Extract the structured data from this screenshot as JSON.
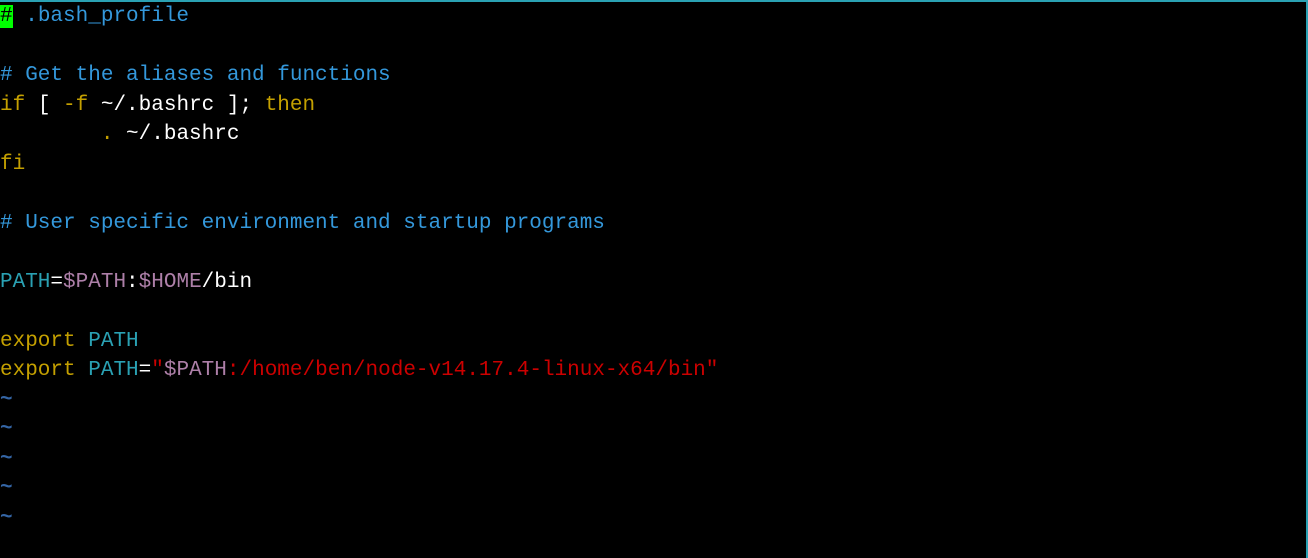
{
  "editor": {
    "lines": [
      {
        "segments": [
          {
            "text": "#",
            "class": "cursor"
          },
          {
            "text": " .bash_profile",
            "class": "comment"
          }
        ]
      },
      {
        "segments": []
      },
      {
        "segments": [
          {
            "text": "# Get the aliases and functions",
            "class": "comment"
          }
        ]
      },
      {
        "segments": [
          {
            "text": "if",
            "class": "keyword"
          },
          {
            "text": " [ ",
            "class": "plain"
          },
          {
            "text": "-f",
            "class": "keyword"
          },
          {
            "text": " ~/.bashrc ",
            "class": "plain"
          },
          {
            "text": "];",
            "class": "plain"
          },
          {
            "text": " ",
            "class": "plain"
          },
          {
            "text": "then",
            "class": "keyword"
          }
        ]
      },
      {
        "segments": [
          {
            "text": "        ",
            "class": "plain"
          },
          {
            "text": ".",
            "class": "keyword"
          },
          {
            "text": " ~/.bashrc",
            "class": "plain"
          }
        ]
      },
      {
        "segments": [
          {
            "text": "fi",
            "class": "keyword"
          }
        ]
      },
      {
        "segments": []
      },
      {
        "segments": [
          {
            "text": "# User specific environment and startup programs",
            "class": "comment"
          }
        ]
      },
      {
        "segments": []
      },
      {
        "segments": [
          {
            "text": "PATH",
            "class": "identifier"
          },
          {
            "text": "=",
            "class": "equals"
          },
          {
            "text": "$PATH",
            "class": "variable"
          },
          {
            "text": ":",
            "class": "plain"
          },
          {
            "text": "$HOME",
            "class": "variable"
          },
          {
            "text": "/bin",
            "class": "plain"
          }
        ]
      },
      {
        "segments": []
      },
      {
        "segments": [
          {
            "text": "export",
            "class": "keyword"
          },
          {
            "text": " ",
            "class": "plain"
          },
          {
            "text": "PATH",
            "class": "identifier"
          }
        ]
      },
      {
        "segments": [
          {
            "text": "export",
            "class": "keyword"
          },
          {
            "text": " ",
            "class": "plain"
          },
          {
            "text": "PATH",
            "class": "identifier"
          },
          {
            "text": "=",
            "class": "equals"
          },
          {
            "text": "\"",
            "class": "string-path"
          },
          {
            "text": "$PATH",
            "class": "variable"
          },
          {
            "text": ":/home/ben/node-v14.17.4-linux-x64/bin",
            "class": "string-path"
          },
          {
            "text": "\"",
            "class": "string-path"
          }
        ]
      },
      {
        "segments": [
          {
            "text": "~",
            "class": "tilde"
          }
        ]
      },
      {
        "segments": [
          {
            "text": "~",
            "class": "tilde"
          }
        ]
      },
      {
        "segments": [
          {
            "text": "~",
            "class": "tilde"
          }
        ]
      },
      {
        "segments": [
          {
            "text": "~",
            "class": "tilde"
          }
        ]
      },
      {
        "segments": [
          {
            "text": "~",
            "class": "tilde"
          }
        ]
      }
    ]
  }
}
